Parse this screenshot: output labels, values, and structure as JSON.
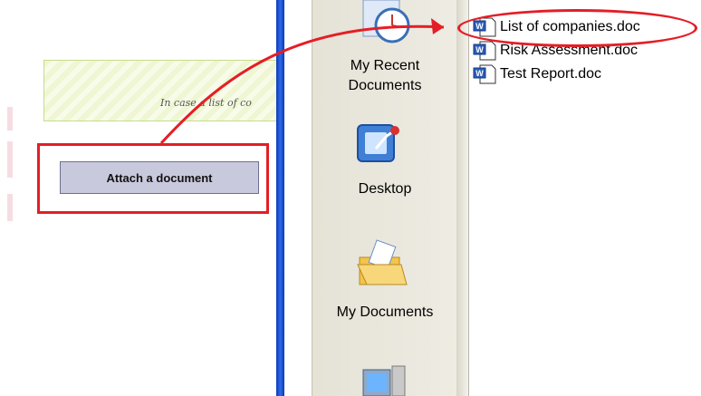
{
  "form": {
    "hint_text": "In case a list of co",
    "attach_button_label": "Attach a document"
  },
  "places": [
    {
      "label_line1": "My Recent",
      "label_line2": "Documents",
      "icon": "recent-documents-icon"
    },
    {
      "label_line1": "Desktop",
      "label_line2": "",
      "icon": "desktop-icon"
    },
    {
      "label_line1": "My Documents",
      "label_line2": "",
      "icon": "my-documents-icon"
    },
    {
      "label_line1": "",
      "label_line2": "",
      "icon": "my-computer-icon"
    }
  ],
  "files": [
    {
      "name": "List of companies.doc",
      "icon": "word-document-icon"
    },
    {
      "name": "Risk Assessment.doc",
      "icon": "word-document-icon"
    },
    {
      "name": "Test Report.doc",
      "icon": "word-document-icon"
    }
  ],
  "colors": {
    "highlight_red": "#e41e26",
    "xp_blue": "#0a3ab8",
    "button_fill": "#c9c9dd"
  }
}
